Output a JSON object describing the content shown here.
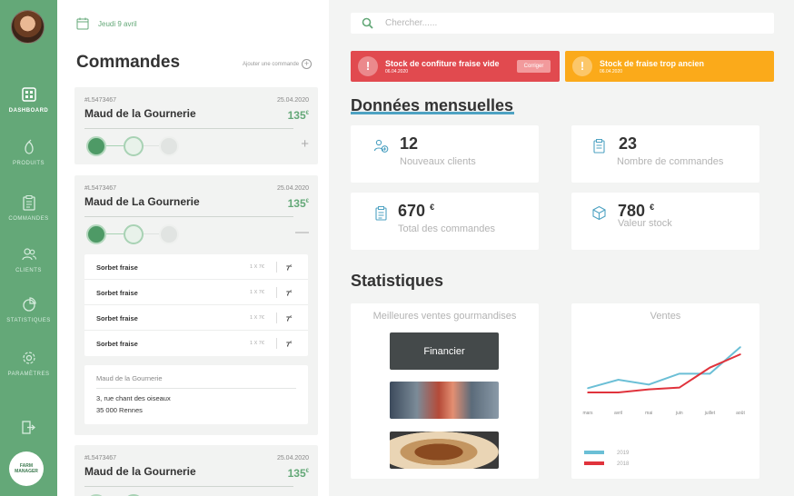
{
  "sidebar": {
    "items": [
      {
        "label": "DASHBOARD",
        "icon": "dashboard-icon",
        "active": true
      },
      {
        "label": "PRODUITS",
        "icon": "pear-icon",
        "active": false
      },
      {
        "label": "COMMANDES",
        "icon": "clipboard-icon",
        "active": false
      },
      {
        "label": "CLIENTS",
        "icon": "users-icon",
        "active": false
      },
      {
        "label": "STATISTIQUES",
        "icon": "pie-chart-icon",
        "active": false
      },
      {
        "label": "PARAMÈTRES",
        "icon": "gear-icon",
        "active": false
      }
    ],
    "logout_icon": "logout-icon",
    "brand": {
      "line1": "FARM",
      "line2": "MANAGER"
    }
  },
  "orders": {
    "date": "Jeudi 9 avril",
    "title": "Commandes",
    "add_label": "Ajouter une commande",
    "list": [
      {
        "ref": "#L5473467",
        "date": "25.04.2020",
        "name": "Maud de la Gournerie",
        "price": "135",
        "currency": "€",
        "toggle": "+"
      },
      {
        "ref": "#L5473467",
        "date": "25.04.2020",
        "name": "Maud de La Gournerie",
        "price": "135",
        "currency": "€",
        "toggle": "—",
        "items": [
          {
            "name": "Sorbet fraise",
            "qty": "1 X 7€",
            "price": "7",
            "currency": "€"
          },
          {
            "name": "Sorbet fraise",
            "qty": "1 X 7€",
            "price": "7",
            "currency": "€"
          },
          {
            "name": "Sorbet fraise",
            "qty": "1 X 7€",
            "price": "7",
            "currency": "€"
          },
          {
            "name": "Sorbet fraise",
            "qty": "1 X 7€",
            "price": "7",
            "currency": "€"
          }
        ],
        "address": {
          "name": "Maud de la Gournerie",
          "line1": "3, rue chant des oiseaux",
          "line2": "35 000 Rennes"
        }
      },
      {
        "ref": "#L5473467",
        "date": "25.04.2020",
        "name": "Maud de la Gournerie",
        "price": "135",
        "currency": "€"
      }
    ]
  },
  "search": {
    "placeholder": "Chercher......"
  },
  "alerts": [
    {
      "title": "Stock de confiture fraise vide",
      "date": "06.04.2020",
      "button": "Corriger",
      "color": "#e14a4f"
    },
    {
      "title": "Stock de fraise trop ancien",
      "date": "06.04.2020",
      "color": "#fbaa1a"
    }
  ],
  "monthly": {
    "title": "Données mensuelles",
    "metrics": [
      {
        "value": "12",
        "unit": "",
        "label": "Nouveaux clients",
        "icon": "user-add-icon"
      },
      {
        "value": "23",
        "unit": "",
        "label": "Nombre de commandes",
        "icon": "clipboard-icon"
      },
      {
        "value": "670",
        "unit": "€",
        "label": "Total des commandes",
        "icon": "clipboard-icon"
      },
      {
        "value": "780",
        "unit": "€",
        "label": "Valeur stock",
        "icon": "box-icon"
      }
    ]
  },
  "stats": {
    "title": "Statistiques",
    "best_sellers": {
      "title": "Meilleures ventes gourmandises",
      "items": [
        {
          "caption": "Financier"
        },
        {
          "caption": ""
        },
        {
          "caption": ""
        }
      ]
    },
    "sales": {
      "title": "Ventes"
    }
  },
  "chart_data": {
    "type": "line",
    "title": "Ventes",
    "categories": [
      "mars",
      "avril",
      "mai",
      "juin",
      "juillet",
      "août"
    ],
    "series": [
      {
        "name": "2019",
        "color": "#6bbfd6",
        "values": [
          1.0,
          2.4,
          1.6,
          3.4,
          3.4,
          7.8
        ]
      },
      {
        "name": "2018",
        "color": "#e0333c",
        "values": [
          0.3,
          0.3,
          0.8,
          1.1,
          4.4,
          6.6
        ]
      }
    ],
    "ylim": [
      0,
      9
    ],
    "grid": false,
    "legend": "bottom-left"
  },
  "colors": {
    "accent": "#64a878",
    "alert_red": "#e14a4f",
    "alert_orange": "#fbaa1a",
    "underline": "#4ea2c2"
  }
}
